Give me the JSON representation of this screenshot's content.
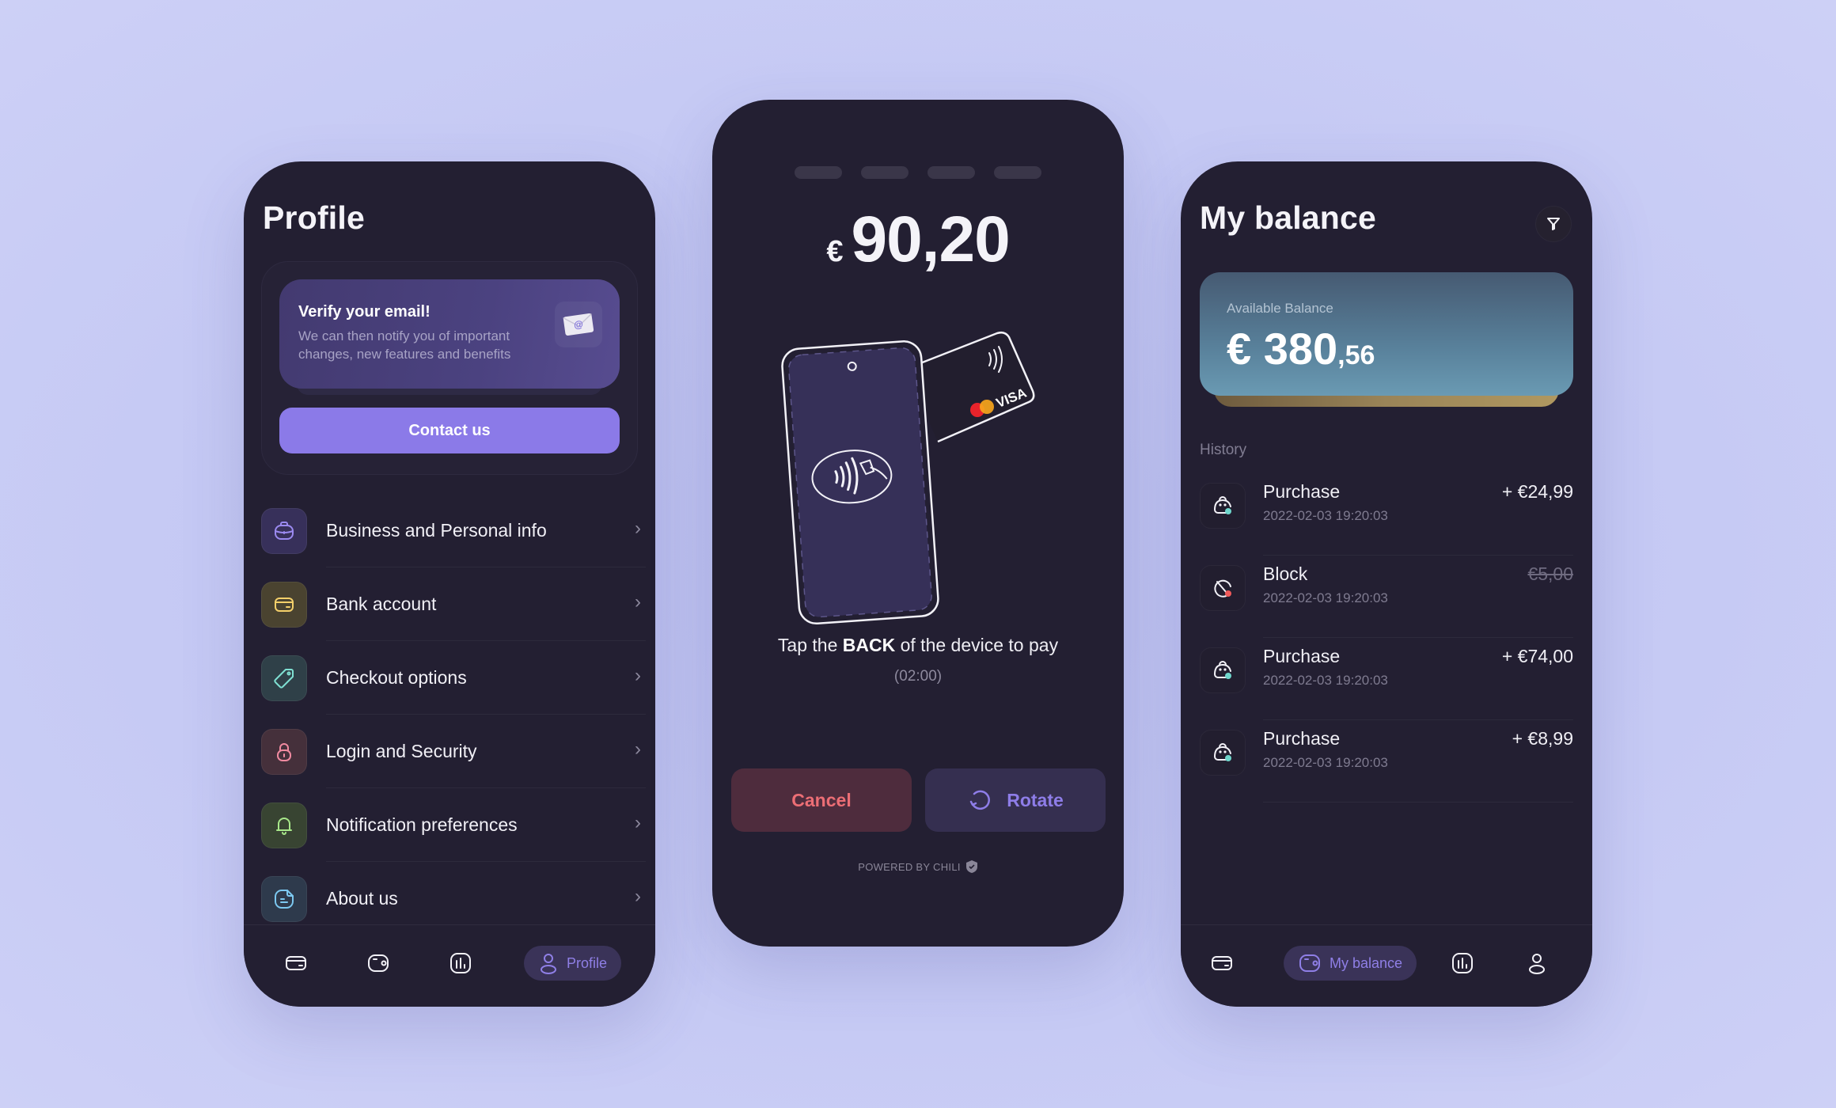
{
  "profile_screen": {
    "title": "Profile",
    "verify": {
      "title": "Verify your email!",
      "text": "We can then notify you of important changes, new features and benefits",
      "icon": "envelope-at-icon",
      "button": "Contact us"
    },
    "menu": [
      {
        "label": "Business and Personal info",
        "icon": "briefcase-icon",
        "color": "#9b8af0",
        "bg": "#37305a"
      },
      {
        "label": "Bank account",
        "icon": "card-icon",
        "color": "#f4d06a",
        "bg": "#4a4330"
      },
      {
        "label": "Checkout options",
        "icon": "tag-icon",
        "color": "#7fe0d2",
        "bg": "#2f4048"
      },
      {
        "label": "Login and Security",
        "icon": "lock-icon",
        "color": "#f08aa0",
        "bg": "#45303b"
      },
      {
        "label": "Notification preferences",
        "icon": "bell-icon",
        "color": "#a8e88a",
        "bg": "#384432"
      },
      {
        "label": "About us",
        "icon": "document-icon",
        "color": "#7cc8f0",
        "bg": "#2e3a4c"
      }
    ],
    "tabbar": {
      "items": [
        "card-icon",
        "wallet-icon",
        "chart-icon",
        "profile-icon"
      ],
      "active_label": "Profile"
    }
  },
  "pay_screen": {
    "steps": 4,
    "currency": "€",
    "amount": "90,20",
    "card_brands": [
      "Mastercard",
      "VISA"
    ],
    "visa_label": "VISA",
    "instruction_pre": "Tap the ",
    "instruction_bold": "BACK",
    "instruction_post": " of the device to pay",
    "timer": "(02:00)",
    "cancel_label": "Cancel",
    "rotate_label": "Rotate",
    "powered_by": "POWERED BY CHILI"
  },
  "balance_screen": {
    "title": "My balance",
    "balance_label": "Available Balance",
    "balance_main": "€ 380",
    "balance_cents": ",56",
    "history_label": "History",
    "history": [
      {
        "name": "Purchase",
        "date": "2022-02-03 19:20:03",
        "amount": "+ €24,99",
        "status": "success",
        "struck": false
      },
      {
        "name": "Block",
        "date": "2022-02-03 19:20:03",
        "amount": "€5,00",
        "status": "blocked",
        "struck": true
      },
      {
        "name": "Purchase",
        "date": "2022-02-03 19:20:03",
        "amount": "+ €74,00",
        "status": "success",
        "struck": false
      },
      {
        "name": "Purchase",
        "date": "2022-02-03 19:20:03",
        "amount": "+ €8,99",
        "status": "success",
        "struck": false
      }
    ],
    "status_colors": {
      "success": "#6fd6cc",
      "blocked": "#f05a5a"
    },
    "tabbar": {
      "items": [
        "card-icon",
        "wallet-icon",
        "chart-icon",
        "profile-icon"
      ],
      "active_label": "My balance"
    }
  }
}
